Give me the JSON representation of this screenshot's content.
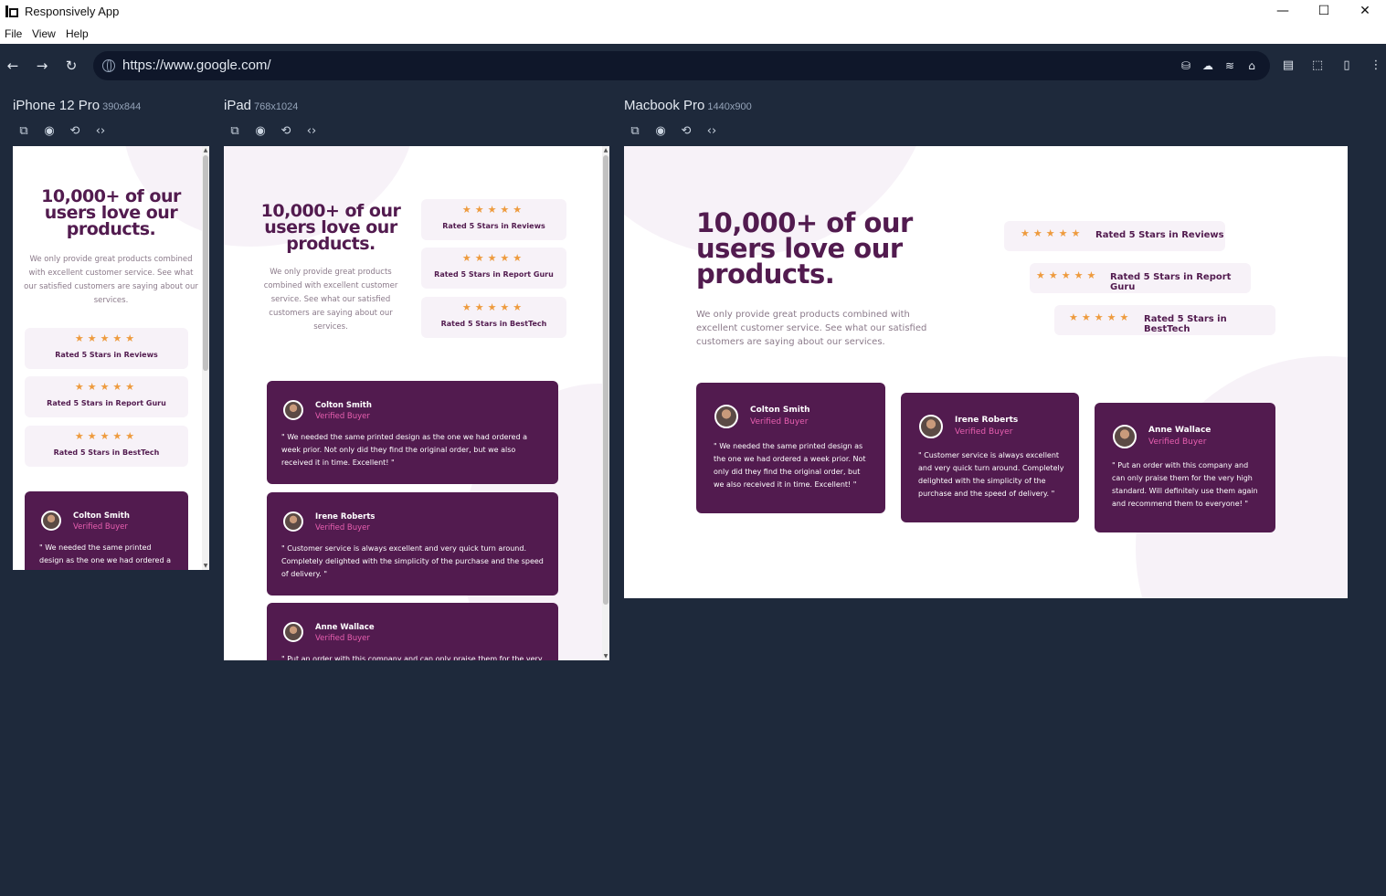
{
  "app": {
    "title": "Responsively App",
    "menu": [
      "File",
      "View",
      "Help"
    ],
    "window_controls": {
      "minimize": "—",
      "maximize": "☐",
      "close": "✕"
    }
  },
  "toolbar": {
    "back": "←",
    "forward": "→",
    "reload": "↻",
    "url": "https://www.google.com/"
  },
  "devices": [
    {
      "name": "iPhone 12 Pro",
      "dims": "390x844"
    },
    {
      "name": "iPad",
      "dims": "768x1024"
    },
    {
      "name": "Macbook Pro",
      "dims": "1440x900"
    }
  ],
  "device_tools": [
    "screenshot-full-icon",
    "camera-icon",
    "rotate-icon",
    "code-icon"
  ],
  "site": {
    "heading": "10,000+ of our users love our products.",
    "lead": "We only provide great products combined with excellent customer service. See what our satisfied customers are saying about our services.",
    "stars": "★★★★★",
    "ratings": [
      "Rated 5 Stars in Reviews",
      "Rated 5 Stars in Report Guru",
      "Rated 5 Stars in BestTech"
    ],
    "testimonials": [
      {
        "name": "Colton Smith",
        "verified": "Verified Buyer",
        "text": "\" We needed the same printed design as the one we had ordered a week prior. Not only did they find the original order, but we also received it in time. Excellent! \""
      },
      {
        "name": "Irene Roberts",
        "verified": "Verified Buyer",
        "text": "\" Customer service is always excellent and very quick turn around. Completely delighted with the simplicity of the purchase and the speed of delivery. \""
      },
      {
        "name": "Anne Wallace",
        "verified": "Verified Buyer",
        "text": "\" Put an order with this company and can only praise them for the very high standard. Will definitely use them again and recommend them to everyone! \""
      }
    ]
  },
  "colors": {
    "workspace": "#1e293b",
    "purple": "#521b4f",
    "pink": "#e85fb0",
    "star": "#ee9b3e",
    "light": "#f7f2f8"
  }
}
